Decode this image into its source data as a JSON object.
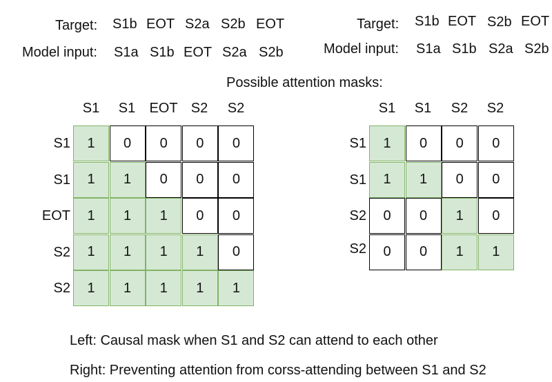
{
  "top_left": {
    "target_label": "Target:",
    "target_tokens": [
      "S1b",
      "EOT",
      "S2a",
      "S2b",
      "EOT"
    ],
    "input_label": "Model input:",
    "input_tokens": [
      "S1a",
      "S1b",
      "EOT",
      "S2a",
      "S2b"
    ]
  },
  "top_right": {
    "target_label": "Target:",
    "target_tokens": [
      "S1b",
      "EOT",
      "S2b",
      "EOT"
    ],
    "input_label": "Model input:",
    "input_tokens": [
      "S1a",
      "S1b",
      "S2a",
      "S2b"
    ]
  },
  "section_title": "Possible attention masks:",
  "left_mask": {
    "columns": [
      "S1",
      "S1",
      "EOT",
      "S2",
      "S2"
    ],
    "rows": [
      "S1",
      "S1",
      "EOT",
      "S2",
      "S2"
    ],
    "values": [
      [
        1,
        0,
        0,
        0,
        0
      ],
      [
        1,
        1,
        0,
        0,
        0
      ],
      [
        1,
        1,
        1,
        0,
        0
      ],
      [
        1,
        1,
        1,
        1,
        0
      ],
      [
        1,
        1,
        1,
        1,
        1
      ]
    ]
  },
  "right_mask": {
    "columns": [
      "S1",
      "S1",
      "S2",
      "S2"
    ],
    "rows": [
      "S1",
      "S1",
      "S2",
      "S2"
    ],
    "values": [
      [
        1,
        0,
        0,
        0
      ],
      [
        1,
        1,
        0,
        0
      ],
      [
        0,
        0,
        1,
        0
      ],
      [
        0,
        0,
        1,
        1
      ]
    ]
  },
  "caption_left": "Left: Causal mask when S1 and S2 can attend to each other",
  "caption_right": "Right: Preventing attention from corss-attending between S1 and S2",
  "colors": {
    "active_fill": "#d5e8d4",
    "active_border": "#82b366",
    "inactive_border": "#000000"
  }
}
